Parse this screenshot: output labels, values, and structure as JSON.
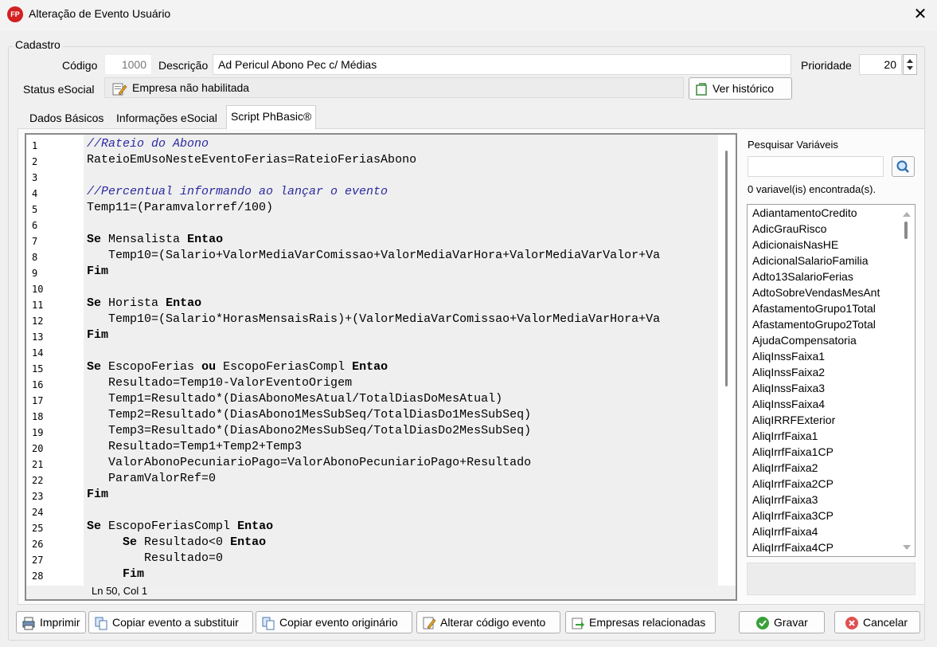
{
  "window": {
    "title": "Alteração de Evento Usuário",
    "app_icon_text": "FP",
    "close_glyph": "✕"
  },
  "cadastro": {
    "group_label": "Cadastro",
    "codigo_label": "Código",
    "codigo_value": "1000",
    "descricao_label": "Descrição",
    "descricao_value": "Ad Pericul Abono Pec c/ Médias",
    "prioridade_label": "Prioridade",
    "prioridade_value": "20",
    "status_label": "Status eSocial",
    "status_value": "Empresa não habilitada",
    "ver_historico_label": "Ver histórico"
  },
  "tabs": [
    {
      "label": "Dados Básicos",
      "active": false
    },
    {
      "label": "Informações eSocial",
      "active": false
    },
    {
      "label": "Script PhBasic®",
      "active": true
    }
  ],
  "editor": {
    "line_numbers": [
      "1",
      "2",
      "3",
      "4",
      "5",
      "6",
      "7",
      "8",
      "9",
      "10",
      "11",
      "12",
      "13",
      "14",
      "15",
      "16",
      "17",
      "18",
      "19",
      "20",
      "21",
      "22",
      "23",
      "24",
      "25",
      "26",
      "27",
      "28"
    ],
    "lines": [
      "//Rateio do Abono",
      "RateioEmUsoNesteEventoFerias=RateioFeriasAbono",
      "",
      "//Percentual informando ao lançar o evento",
      "Temp11=(Paramvalorref/100)",
      "",
      "Se Mensalista Entao",
      "   Temp10=(Salario+ValorMediaVarComissao+ValorMediaVarHora+ValorMediaVarValor+Va",
      "Fim",
      "",
      "Se Horista Entao",
      "   Temp10=(Salario*HorasMensaisRais)+(ValorMediaVarComissao+ValorMediaVarHora+Va",
      "Fim",
      "",
      "Se EscopoFerias ou EscopoFeriasCompl Entao",
      "   Resultado=Temp10-ValorEventoOrigem",
      "   Temp1=Resultado*(DiasAbonoMesAtual/TotalDiasDoMesAtual)",
      "   Temp2=Resultado*(DiasAbono1MesSubSeq/TotalDiasDo1MesSubSeq)",
      "   Temp3=Resultado*(DiasAbono2MesSubSeq/TotalDiasDo2MesSubSeq)",
      "   Resultado=Temp1+Temp2+Temp3",
      "   ValorAbonoPecuniarioPago=ValorAbonoPecuniarioPago+Resultado",
      "   ParamValorRef=0",
      "Fim",
      "",
      "Se EscopoFeriasCompl Entao",
      "     Se Resultado<0 Entao",
      "        Resultado=0",
      "     Fim"
    ],
    "status": "Ln 50, Col 1"
  },
  "variables": {
    "search_label": "Pesquisar Variáveis",
    "search_value": "",
    "count_text": "0 variavel(is) encontrada(s).",
    "items": [
      "AdiantamentoCredito",
      "AdicGrauRisco",
      "AdicionaisNasHE",
      "AdicionalSalarioFamilia",
      "Adto13SalarioFerias",
      "AdtoSobreVendasMesAnt",
      "AfastamentoGrupo1Total",
      "AfastamentoGrupo2Total",
      "AjudaCompensatoria",
      "AliqInssFaixa1",
      "AliqInssFaixa2",
      "AliqInssFaixa3",
      "AliqInssFaixa4",
      "AliqIRRFExterior",
      "AliqIrrfFaixa1",
      "AliqIrrfFaixa1CP",
      "AliqIrrfFaixa2",
      "AliqIrrfFaixa2CP",
      "AliqIrrfFaixa3",
      "AliqIrrfFaixa3CP",
      "AliqIrrfFaixa4",
      "AliqIrrfFaixa4CP"
    ]
  },
  "footer": {
    "imprimir": "Imprimir",
    "copiar_substituir": "Copiar evento a substituir",
    "copiar_originario": "Copiar evento originário",
    "alterar_codigo": "Alterar código evento",
    "empresas_relacionadas": "Empresas relacionadas",
    "gravar": "Gravar",
    "cancelar": "Cancelar"
  },
  "colors": {
    "comment": "#2a2aa0",
    "accent_red": "#d32020",
    "gravar_green": "#3aa13a",
    "cancel_red": "#e05050"
  }
}
